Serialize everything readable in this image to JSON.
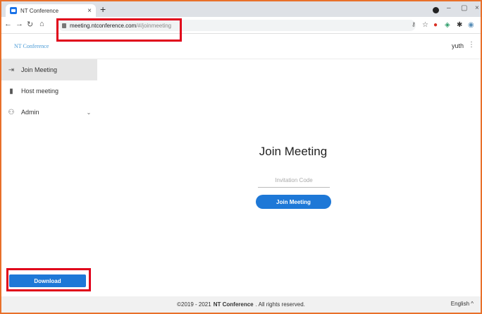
{
  "browser": {
    "tab_title": "NT Conference",
    "tab_close": "×",
    "new_tab": "+",
    "url_host": "meeting.ntconference.com",
    "url_path": "/#/joinmeeting",
    "minimize": "–",
    "maximize": "▢",
    "close": "×"
  },
  "header": {
    "brand": "NT Conference",
    "user": "yuth"
  },
  "sidebar": {
    "items": [
      {
        "label": "Join Meeting",
        "icon": "sign-in-icon"
      },
      {
        "label": "Host meeting",
        "icon": "phone-icon"
      },
      {
        "label": "Admin",
        "icon": "admin-icon"
      }
    ],
    "download_label": "Download"
  },
  "main": {
    "title": "Join Meeting",
    "code_placeholder": "Invitation Code",
    "code_value": "",
    "join_label": "Join Meeting"
  },
  "footer": {
    "copyright_prefix": "©2019 - 2021",
    "company": "NT Conference",
    "copyright_suffix": ". All rights reserved.",
    "language": "English ^"
  },
  "colors": {
    "primary": "#1e78d7",
    "highlight": "#e0001a",
    "frame": "#e8702a"
  }
}
